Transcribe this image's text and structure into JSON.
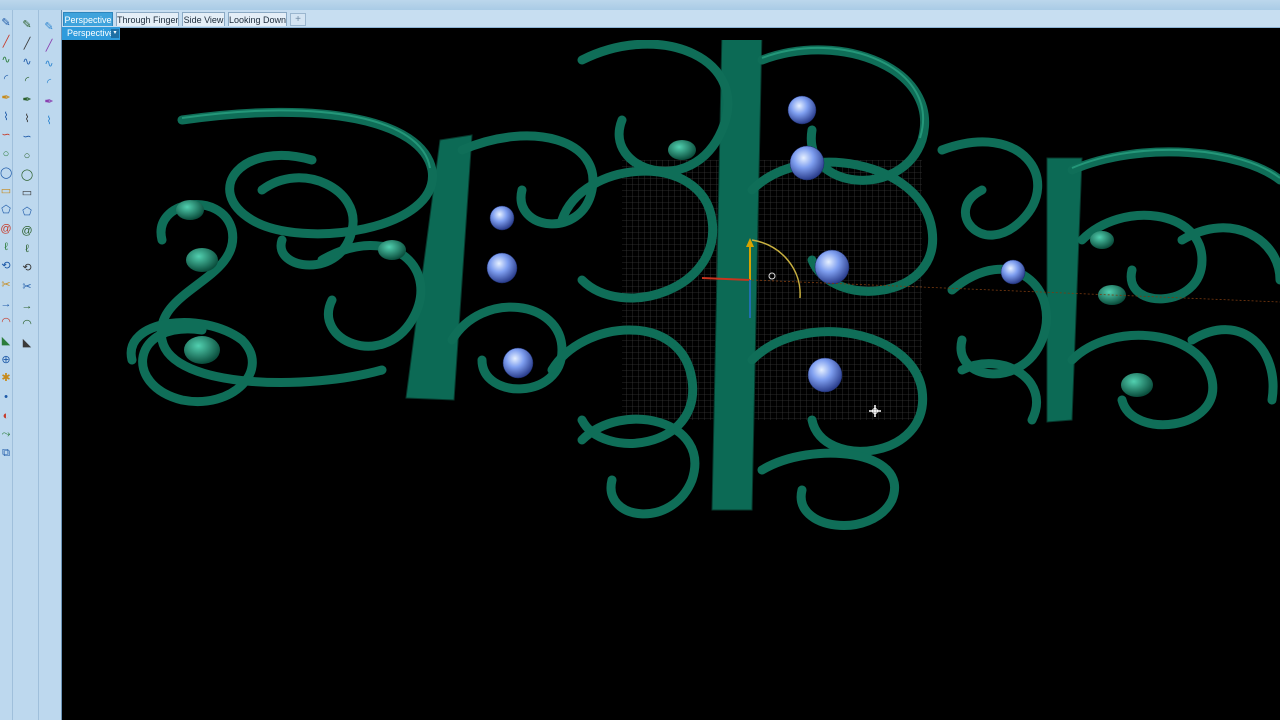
{
  "tabs": [
    {
      "label": "Perspective",
      "active": true
    },
    {
      "label": "Through Finger",
      "active": false
    },
    {
      "label": "Side View",
      "active": false
    },
    {
      "label": "Looking Down",
      "active": false
    }
  ],
  "tab_add_label": "+",
  "viewport": {
    "name": "Perspective",
    "caret": "▾"
  },
  "colors": {
    "panel": "#bdd8ee",
    "tab_active": "#3fa3dc",
    "background": "#000000",
    "ribbon": "#0f6e58",
    "gem": "#6f90e8"
  },
  "toolbar": {
    "col1": [
      "brush-icon",
      "line-icon",
      "curve-icon",
      "arc-icon",
      "pen-icon",
      "polyline-icon",
      "bezier-icon",
      "circle-icon",
      "ellipse-icon",
      "rectangle-icon",
      "polygon-icon",
      "spiral-icon",
      "helix-icon",
      "offset-icon",
      "trim-icon",
      "extend-icon",
      "fillet-icon",
      "chamfer-icon",
      "join-icon",
      "explode-icon",
      "point-icon",
      "blend-icon",
      "sweep-icon",
      "loft-icon"
    ],
    "col2": [
      "gem-icon",
      "grid-icon",
      "tree-icon",
      "mesh-icon",
      "pillar-icon",
      "ring-icon",
      "frame-icon",
      "shank-icon",
      "prong-icon",
      "bezel-icon",
      "seat-icon",
      "halo-icon",
      "channel-icon",
      "pave-icon",
      "cluster-icon",
      "filigree-icon",
      "engrave-icon",
      "text-icon"
    ],
    "col3": [
      "move-icon",
      "rotate-icon",
      "scale-icon",
      "mirror-icon",
      "array-icon",
      "align-icon"
    ]
  }
}
